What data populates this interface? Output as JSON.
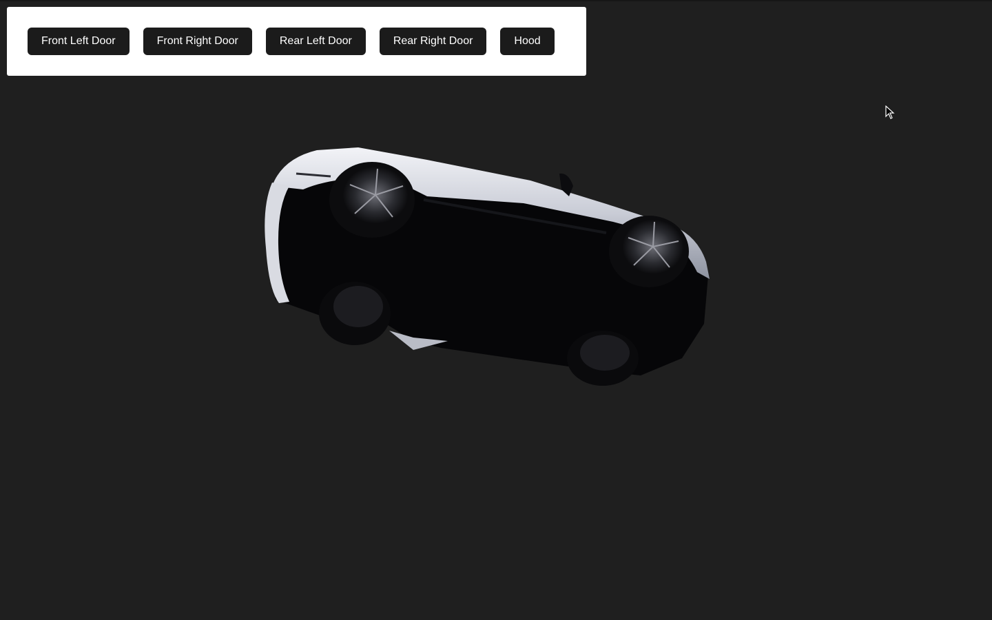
{
  "controls": {
    "buttons": [
      {
        "label": "Front Left Door"
      },
      {
        "label": "Front Right Door"
      },
      {
        "label": "Rear Left Door"
      },
      {
        "label": "Rear Right Door"
      },
      {
        "label": "Hood"
      }
    ]
  },
  "scene": {
    "background_color": "#1f1f1f",
    "model": "car-3d-model",
    "car_body_color": "#e4e6ec",
    "pointer_icon": "arrow-cursor-icon"
  }
}
